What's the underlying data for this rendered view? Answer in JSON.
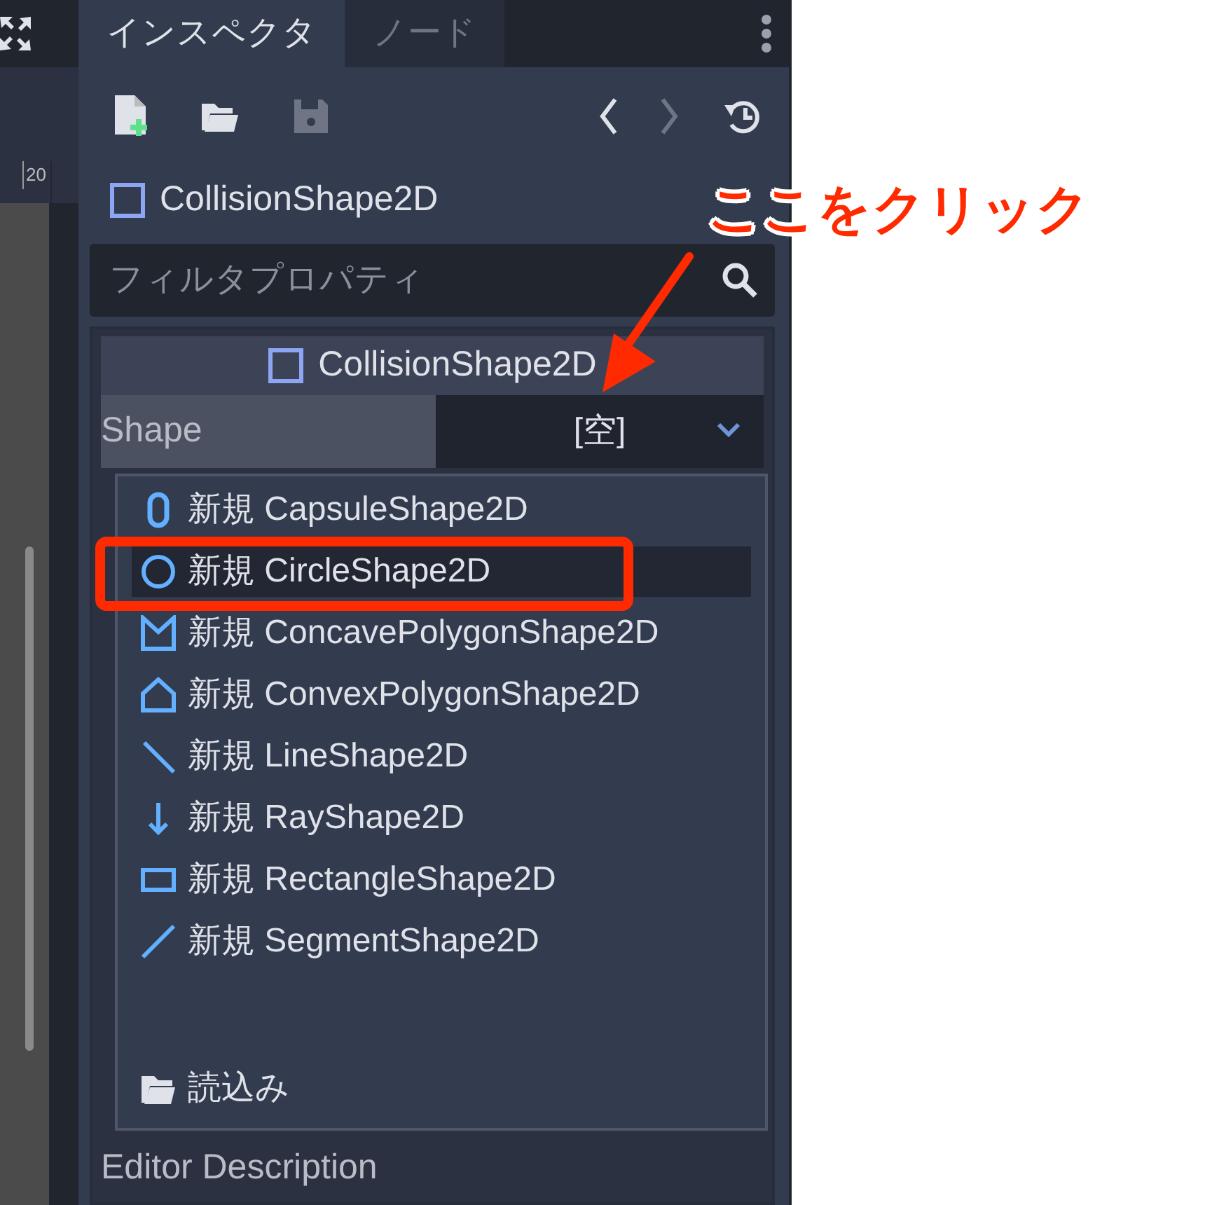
{
  "viewport": {
    "ruler_label": "20"
  },
  "inspector": {
    "tabs": [
      {
        "label": "インスペクタ",
        "selected": true
      },
      {
        "label": "ノード",
        "selected": false
      }
    ],
    "toolbar": [
      {
        "kind": "new",
        "disabled": false
      },
      {
        "kind": "open",
        "disabled": false
      },
      {
        "kind": "save",
        "disabled": true
      },
      {
        "kind": "back",
        "disabled": false
      },
      {
        "kind": "forward",
        "disabled": true
      },
      {
        "kind": "history",
        "disabled": false
      }
    ],
    "object_name": "CollisionShape2D",
    "filter": {
      "placeholder": "フィルタプロパティ"
    },
    "section": {
      "title": "CollisionShape2D",
      "property": {
        "label": "Shape",
        "value": "[空]"
      }
    },
    "footer_property": "Editor Description"
  },
  "dropdown": {
    "items": [
      {
        "kind": "capsule",
        "label": "新規 CapsuleShape2D",
        "selected": false
      },
      {
        "kind": "circle",
        "label": "新規 CircleShape2D",
        "selected": true
      },
      {
        "kind": "concave",
        "label": "新規 ConcavePolygonShape2D",
        "selected": false
      },
      {
        "kind": "convex",
        "label": "新規 ConvexPolygonShape2D",
        "selected": false
      },
      {
        "kind": "line",
        "label": "新規 LineShape2D",
        "selected": false
      },
      {
        "kind": "ray",
        "label": "新規 RayShape2D",
        "selected": false
      },
      {
        "kind": "rectangle",
        "label": "新規 RectangleShape2D",
        "selected": false
      },
      {
        "kind": "segment",
        "label": "新規 SegmentShape2D",
        "selected": false
      }
    ],
    "load": {
      "label": "読込み"
    }
  },
  "annotation": {
    "text": "ここをクリック"
  }
}
